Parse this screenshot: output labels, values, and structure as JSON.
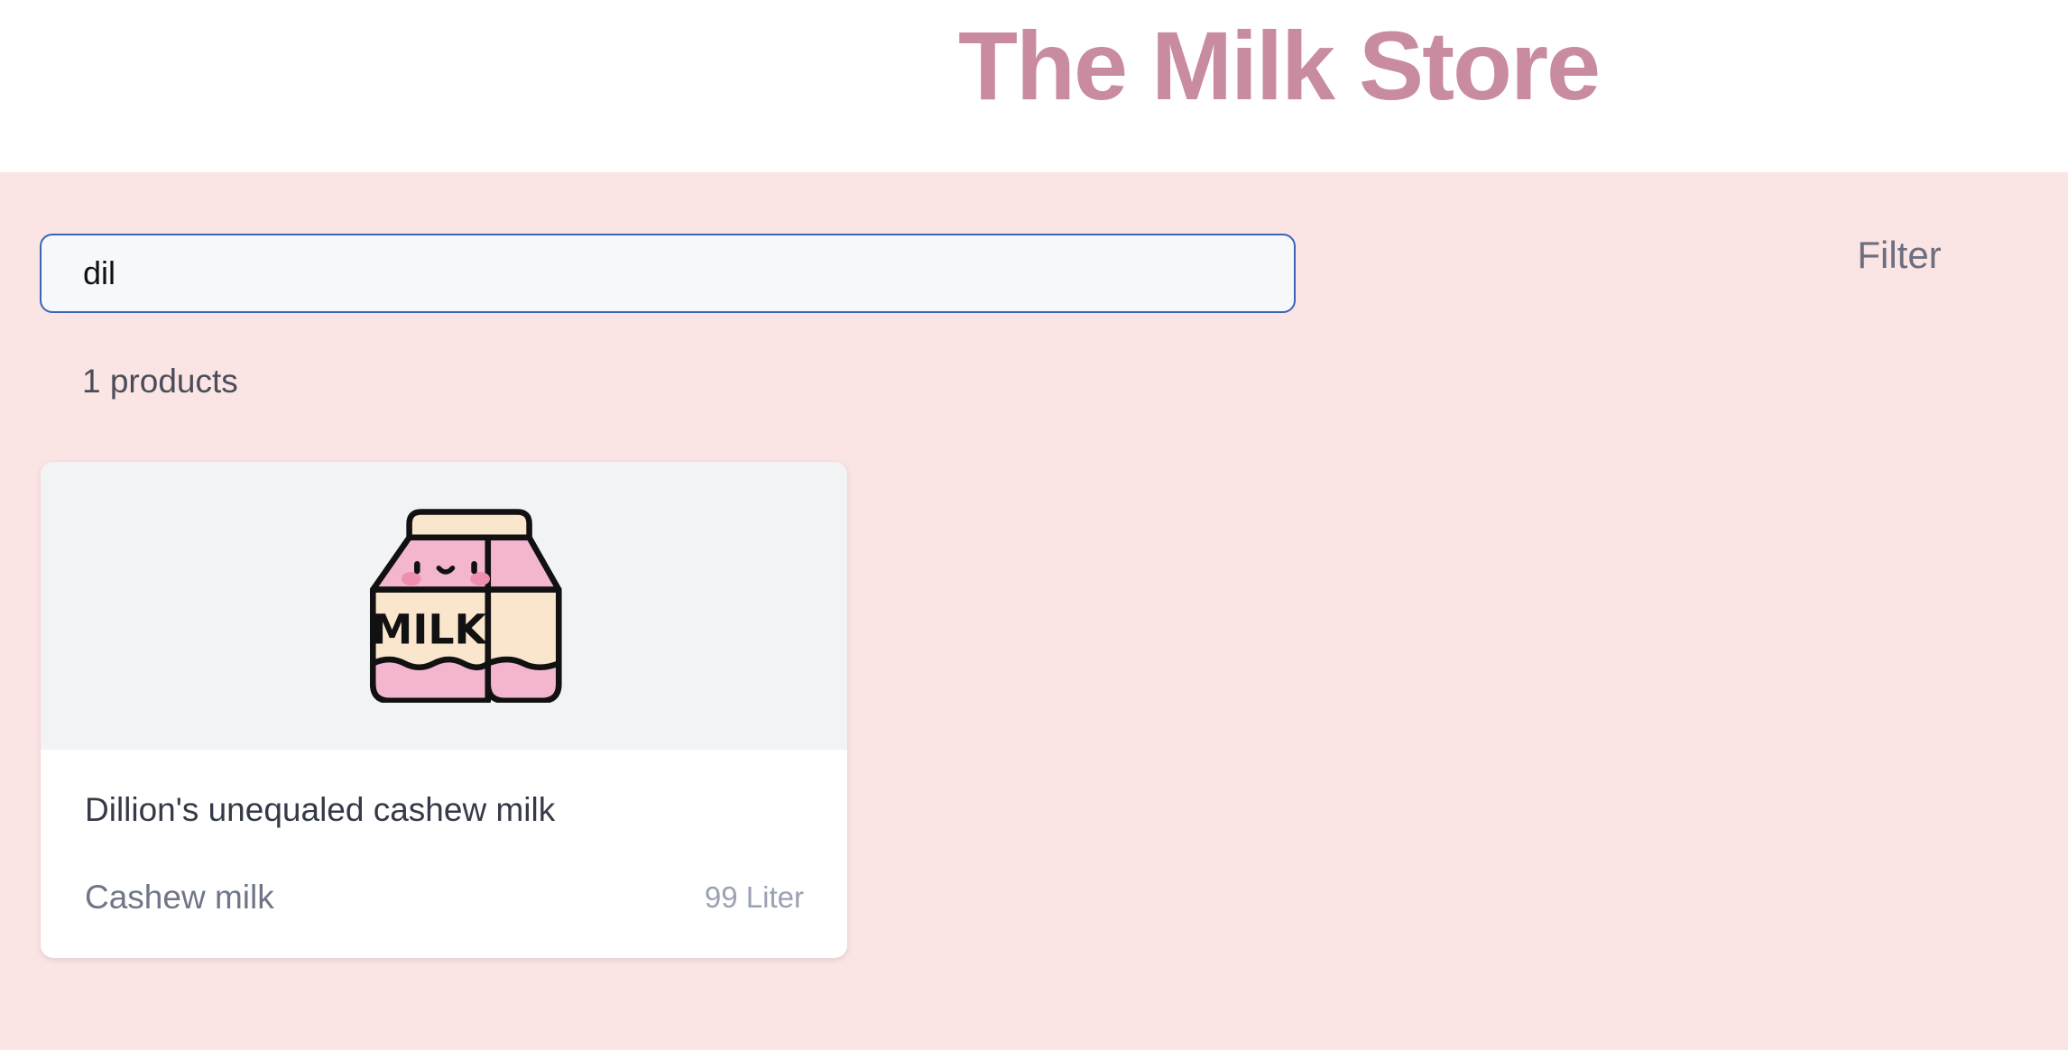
{
  "header": {
    "title": "The Milk Store"
  },
  "search": {
    "value": "dil"
  },
  "filter": {
    "label": "Filter"
  },
  "results": {
    "count_text": "1 products"
  },
  "products": [
    {
      "image_icon": "milk-carton-icon",
      "image_label": "MILK",
      "name": "Dillion's unequaled cashew milk",
      "category": "Cashew milk",
      "quantity": "99 Liter"
    }
  ],
  "colors": {
    "page_background": "#fbe4e4",
    "header_background": "#ffffff",
    "title": "#c98ba0",
    "search_border": "#3a64b8",
    "card_image_background": "#f2f3f5",
    "milk_pink": "#f4b6cf",
    "milk_cream": "#f9e6cd"
  }
}
